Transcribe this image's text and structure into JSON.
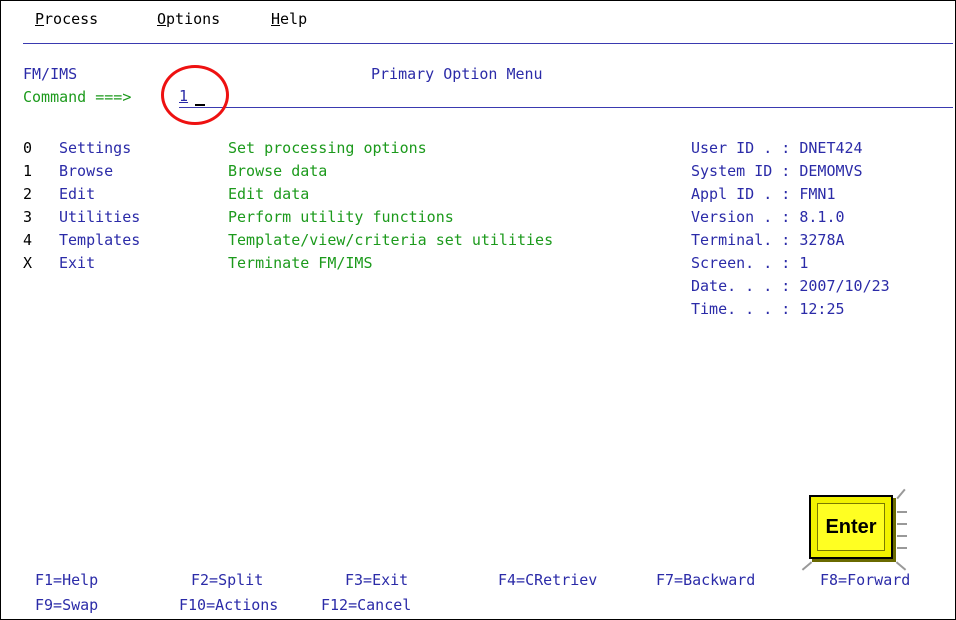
{
  "menubar": {
    "items": [
      {
        "mnemonic": "P",
        "rest": "rocess"
      },
      {
        "mnemonic": "O",
        "rest": "ptions"
      },
      {
        "mnemonic": "H",
        "rest": "elp"
      }
    ]
  },
  "panel": {
    "app_id": "FM/IMS",
    "title": "Primary Option Menu",
    "command_label": "Command ===>",
    "command_value": "1"
  },
  "options": [
    {
      "key": "0",
      "name": "Settings",
      "desc": "Set processing options"
    },
    {
      "key": "1",
      "name": "Browse",
      "desc": "Browse data"
    },
    {
      "key": "2",
      "name": "Edit",
      "desc": "Edit data"
    },
    {
      "key": "3",
      "name": "Utilities",
      "desc": "Perform utility functions"
    },
    {
      "key": "4",
      "name": "Templates",
      "desc": "Template/view/criteria set utilities"
    },
    {
      "key": "X",
      "name": "Exit",
      "desc": "Terminate FM/IMS"
    }
  ],
  "info": [
    {
      "label": "User ID . :",
      "value": "DNET424"
    },
    {
      "label": "System ID :",
      "value": "DEMOMVS"
    },
    {
      "label": "Appl ID . :",
      "value": "FMN1"
    },
    {
      "label": "Version . :",
      "value": "8.1.0"
    },
    {
      "label": "Terminal. :",
      "value": "3278A"
    },
    {
      "label": "Screen. . :",
      "value": "1"
    },
    {
      "label": "Date. . . :",
      "value": "2007/10/23"
    },
    {
      "label": "Time. . . :",
      "value": "12:25"
    }
  ],
  "pf_keys": {
    "row1": [
      "F1=Help",
      "F2=Split",
      "F3=Exit",
      "F4=CRetriev",
      "F7=Backward",
      "F8=Forward"
    ],
    "row2": [
      "F9=Swap",
      "F10=Actions",
      "F12=Cancel"
    ]
  },
  "enter_key": {
    "label": "Enter"
  },
  "colors": {
    "field_blue": "#2b2ba8",
    "text_green": "#1c9a1c",
    "highlight_red": "#ee1111",
    "key_yellow": "#ffff22"
  }
}
